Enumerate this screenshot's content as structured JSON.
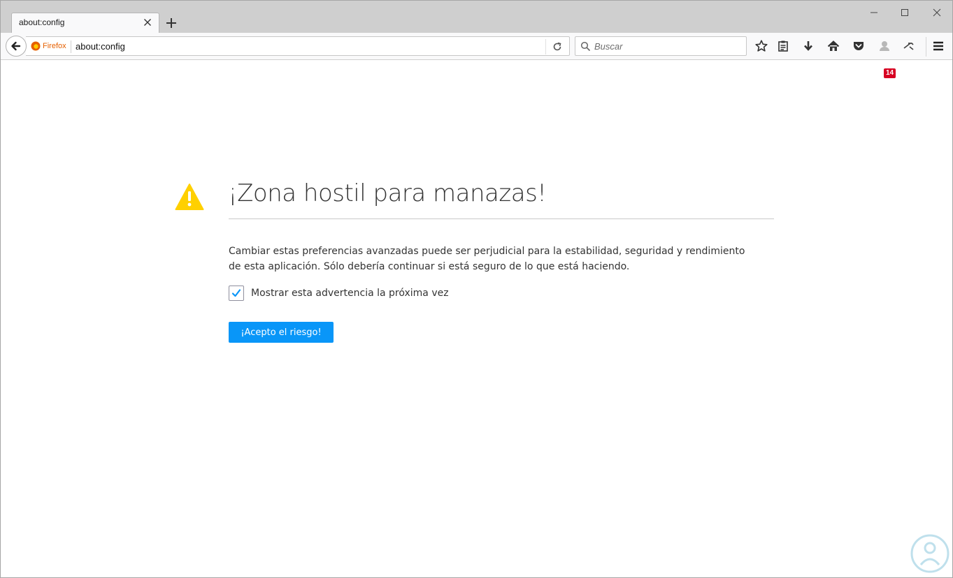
{
  "tab": {
    "title": "about:config"
  },
  "navbar": {
    "identity_label": "Firefox",
    "url": "about:config",
    "search_placeholder": "Buscar",
    "notification_count": "14"
  },
  "icons": {
    "back": "back-arrow-icon",
    "reload": "reload-icon",
    "search": "search-icon",
    "bookmark": "star-icon",
    "reading_list": "clipboard-icon",
    "downloads": "download-icon",
    "home": "home-icon",
    "pocket": "pocket-icon",
    "sync": "account-icon",
    "tools": "developer-tools-icon",
    "menu": "hamburger-menu-icon",
    "warning": "warning-triangle-icon"
  },
  "page": {
    "title": "¡Zona hostil para manazas!",
    "description": "Cambiar estas preferencias avanzadas puede ser perjudicial para la estabilidad, seguridad y rendimiento de esta aplicación. Sólo debería continuar si está seguro de lo que está haciendo.",
    "checkbox_label": "Mostrar esta advertencia la próxima vez",
    "checkbox_checked": true,
    "accept_button": "¡Acepto el riesgo!"
  },
  "colors": {
    "accent": "#0996f8",
    "warning": "#ffd000",
    "firefox": "#e66000",
    "badge": "#d70022"
  }
}
